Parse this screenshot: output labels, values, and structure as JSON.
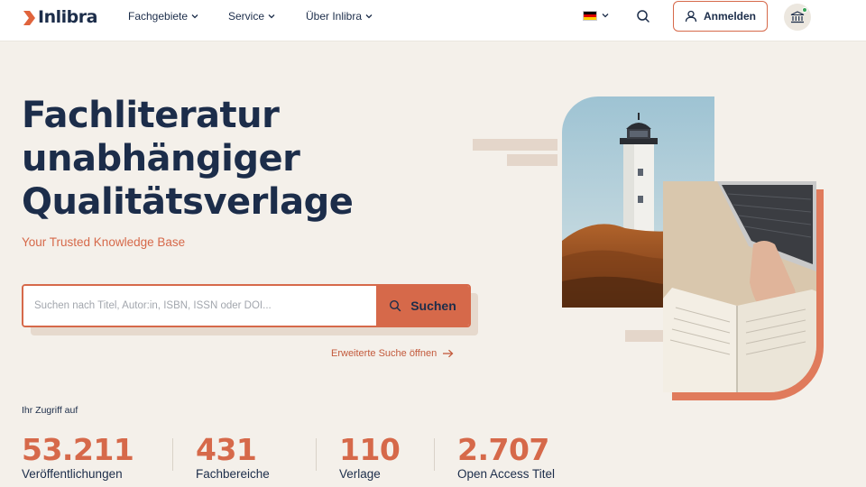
{
  "header": {
    "logo_text": "Inlibra",
    "nav": [
      {
        "label": "Fachgebiete"
      },
      {
        "label": "Service"
      },
      {
        "label": "Über Inlibra"
      }
    ],
    "language_icon": "german-flag-icon",
    "login_label": "Anmelden",
    "institution_icon": "institution-icon"
  },
  "hero": {
    "title_lines": [
      "Fachliteratur",
      "unabhängiger",
      "Qualitätsverlage"
    ],
    "tagline": "Your Trusted Knowledge Base"
  },
  "search": {
    "placeholder": "Suchen nach Titel, Autor:in, ISBN, ISSN oder DOI...",
    "button_label": "Suchen",
    "advanced_label": "Erweiterte Suche öffnen"
  },
  "stats": {
    "intro": "Ihr Zugriff auf",
    "items": [
      {
        "value": "53.211",
        "label": "Veröffentlichungen"
      },
      {
        "value": "431",
        "label": "Fachbereiche"
      },
      {
        "value": "110",
        "label": "Verlage"
      },
      {
        "value": "2.707",
        "label": "Open Access Titel"
      }
    ]
  },
  "colors": {
    "accent": "#d6694a",
    "navy": "#1c2d4a",
    "background": "#f4f0ea"
  }
}
